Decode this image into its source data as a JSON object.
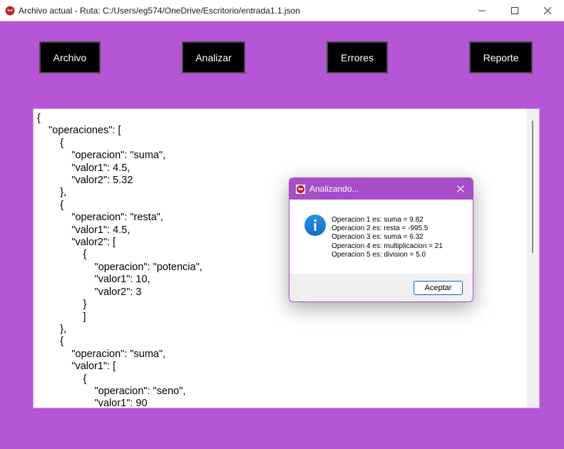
{
  "window": {
    "title": "Archivo actual - Ruta: C:/Users/eg574/OneDrive/Escritorio/entrada1.1.json",
    "minimize_glyph": "—",
    "maximize_glyph": "☐",
    "close_glyph": "✕"
  },
  "toolbar": {
    "archivo_label": "Archivo",
    "analizar_label": "Analizar",
    "errores_label": "Errores",
    "reporte_label": "Reporte"
  },
  "editor": {
    "lines": [
      "{",
      "    \"operaciones\": [",
      "        {",
      "            \"operacion\": \"suma\",",
      "            \"valor1\": 4.5,",
      "            \"valor2\": 5.32",
      "        },",
      "        {",
      "            \"operacion\": \"resta\",",
      "            \"valor1\": 4.5,",
      "            \"valor2\": [",
      "                {",
      "                    \"operacion\": \"potencia\",",
      "                    \"valor1\": 10,",
      "                    \"valor2\": 3",
      "                }",
      "                ]",
      "        },",
      "        {",
      "            \"operacion\": \"suma\",",
      "            \"valor1\": [",
      "                {",
      "                    \"operacion\": \"seno\",",
      "                    \"valor1\": 90"
    ]
  },
  "dialog": {
    "title": "Analizando...",
    "messages": [
      "Operacion 1 es: suma = 9.82",
      "Operacion 2 es: resta = -995.5",
      "Operacion 3 es: suma = 6.32",
      "Operacion 4 es: multiplicacion = 21",
      "Operacion 5 es: division = 5.0"
    ],
    "ok_label": "Aceptar"
  },
  "colors": {
    "background": "#b656d6",
    "dialog_title_bar": "#a64ec9",
    "button_background": "#000000",
    "button_text": "#ffffff",
    "info_icon": "#1a7fd4"
  },
  "icons": {
    "app": "spiderman-app-icon",
    "info": "info-icon"
  }
}
